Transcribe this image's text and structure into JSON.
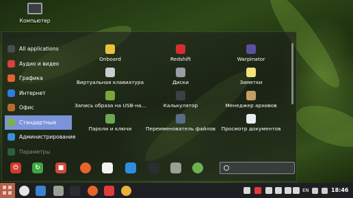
{
  "desktop": {
    "computer_label": "Компьютер"
  },
  "menu": {
    "categories": [
      {
        "label": "All applications",
        "icon": "all-apps-icon",
        "color": "#4a4c52"
      },
      {
        "label": "Аудио и видео",
        "icon": "media-icon",
        "color": "#d9413b"
      },
      {
        "label": "Графика",
        "icon": "graphics-icon",
        "color": "#e2632e"
      },
      {
        "label": "Интернет",
        "icon": "internet-icon",
        "color": "#2f7de1"
      },
      {
        "label": "Офис",
        "icon": "office-icon",
        "color": "#b56a2a"
      },
      {
        "label": "Стандартные",
        "icon": "accessories-icon",
        "color": "#7ab34a",
        "active": true
      },
      {
        "label": "Администрирование",
        "icon": "admin-icon",
        "color": "#3a8fd6"
      },
      {
        "label": "Параметры",
        "icon": "settings-icon",
        "color": "#3fa35f",
        "dim": true
      }
    ],
    "apps": [
      {
        "name": "Onboard",
        "icon": "onboard-icon",
        "color": "#e8c239"
      },
      {
        "name": "Redshift",
        "icon": "redshift-icon",
        "color": "#d42f2f"
      },
      {
        "name": "Warpinator",
        "icon": "warpinator-icon",
        "color": "#5d4fa0"
      },
      {
        "name": "Виртуальная клавиатура",
        "icon": "keyboard-icon",
        "color": "#c9ccd1"
      },
      {
        "name": "Диски",
        "icon": "disks-icon",
        "color": "#9a9ea4"
      },
      {
        "name": "Заметки",
        "icon": "notes-icon",
        "color": "#f4e27a"
      },
      {
        "name": "Запись образа на USB-на...",
        "icon": "usb-writer-icon",
        "color": "#7aa63c"
      },
      {
        "name": "Калькулятор",
        "icon": "calculator-icon",
        "color": "#3e4045"
      },
      {
        "name": "Менеджер архивов",
        "icon": "archive-icon",
        "color": "#c2a062"
      },
      {
        "name": "Пароли и ключи",
        "icon": "passwords-icon",
        "color": "#6ba84f"
      },
      {
        "name": "Переименователь файлов",
        "icon": "renamer-icon",
        "color": "#5a6d86"
      },
      {
        "name": "Просмотр документов",
        "icon": "document-viewer-icon",
        "color": "#e9edf1"
      }
    ],
    "quick_buttons": [
      {
        "icon": "power-icon",
        "color": "#d33a2c",
        "glyph": "⏻"
      },
      {
        "icon": "logout-icon",
        "color": "#3fa645",
        "glyph": "↻"
      },
      {
        "icon": "lock-icon",
        "color": "#d2483b",
        "glyph": "■"
      }
    ],
    "favorites": [
      {
        "icon": "firefox-icon",
        "color": "#e7652a"
      },
      {
        "icon": "software-manager-icon",
        "color": "#f3f3f3"
      },
      {
        "icon": "settings-icon",
        "color": "#2d8ee0"
      },
      {
        "icon": "terminal-icon",
        "color": "#2b2d30"
      },
      {
        "icon": "files-icon",
        "color": "#9aa096"
      },
      {
        "icon": "mint-update-icon",
        "color": "#6cb14f"
      }
    ],
    "search": {
      "value": "",
      "placeholder": ""
    }
  },
  "taskbar": {
    "launchers": [
      {
        "icon": "mint-logo-icon",
        "color": "#e4e6e8"
      },
      {
        "icon": "show-desktop-icon",
        "color": "#3b82d1"
      },
      {
        "icon": "files-icon",
        "color": "#9aa096"
      },
      {
        "icon": "terminal-icon",
        "color": "#2b2d30"
      },
      {
        "icon": "firefox-icon",
        "color": "#e7652a"
      },
      {
        "icon": "yandex-icon",
        "color": "#e23b3b"
      },
      {
        "icon": "chrome-icon",
        "color": "#e8b33a"
      }
    ],
    "tray_icons": [
      {
        "icon": "recorder-icon",
        "color": "#d9d9d9"
      },
      {
        "icon": "yandex-tray-icon",
        "color": "#e23b3b"
      },
      {
        "icon": "bluetooth-icon",
        "color": "#d9d9d9"
      },
      {
        "icon": "shield-icon",
        "color": "#d9d9d9"
      },
      {
        "icon": "network-icon",
        "color": "#d9d9d9"
      },
      {
        "icon": "network-tray-icon",
        "color": "#d9d9d9"
      }
    ],
    "language": "EN",
    "clock": "18:46"
  },
  "colors": {
    "accent": "#7b93d9",
    "taskbar_bg": "#1e1f22",
    "start_button": "#b4604a"
  }
}
